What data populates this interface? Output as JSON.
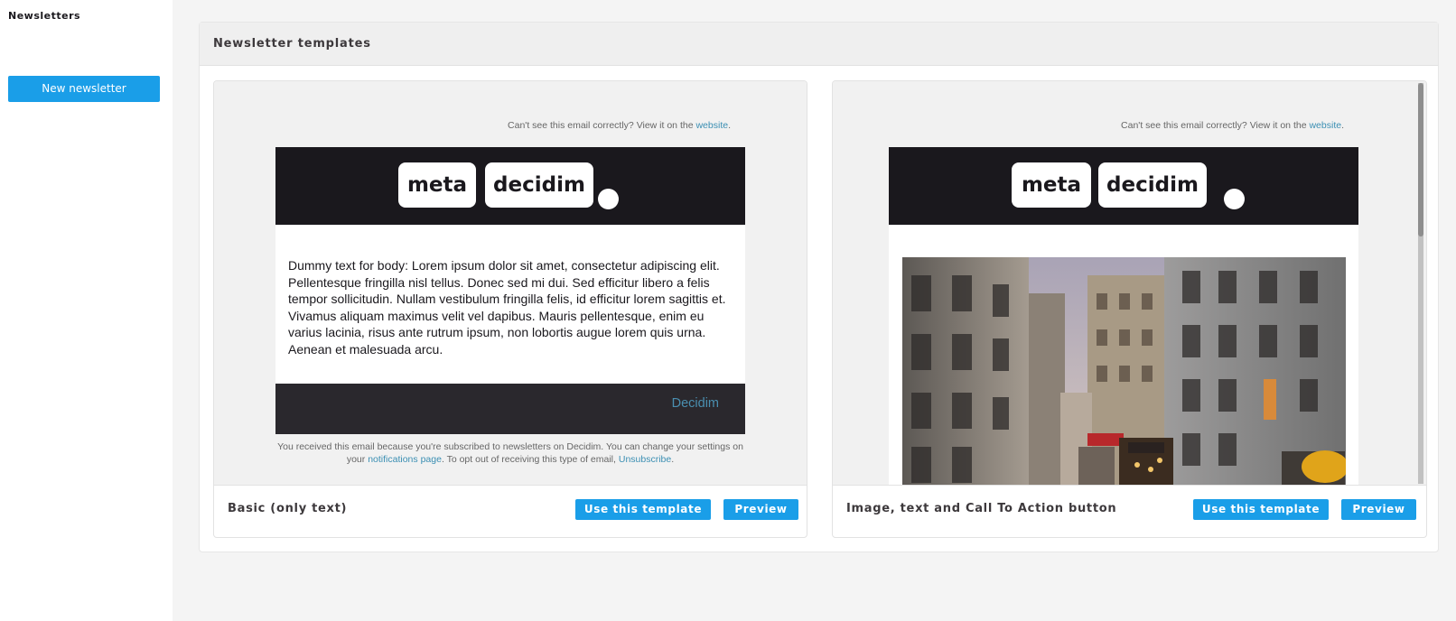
{
  "sidebar": {
    "title": "Newsletters",
    "new_button": "New newsletter"
  },
  "panel": {
    "title": "Newsletter templates"
  },
  "email": {
    "top_note": "Can't see this email correctly? View it on the",
    "top_note_link": "website",
    "top_note_end": ".",
    "logo_meta": "meta",
    "logo_decidim": "decidim",
    "body_text": "Dummy text for body: Lorem ipsum dolor sit amet, consectetur adipiscing elit. Pellentesque fringilla nisl tellus. Donec sed mi dui. Sed efficitur libero a felis tempor sollicitudin. Nullam vestibulum fringilla felis, id efficitur lorem sagittis et. Vivamus aliquam maximus velit vel dapibus. Mauris pellentesque, enim eu varius lacinia, risus ante rutrum ipsum, non lobortis augue lorem quis urna. Aenean et malesuada arcu.",
    "footer_link": "Decidim",
    "bottom_note_1": "You received this email because you're subscribed to newsletters on Decidim. You can change your settings on your",
    "bottom_note_link1": "notifications page",
    "bottom_note_2": ". To opt out of receiving this type of email,",
    "bottom_note_link2": "Unsubscribe",
    "bottom_note_end": "."
  },
  "templates": [
    {
      "name": "Basic (only text)",
      "use_label": "Use this template",
      "preview_label": "Preview"
    },
    {
      "name": "Image, text and Call To Action button",
      "use_label": "Use this template",
      "preview_label": "Preview"
    }
  ],
  "colors": {
    "accent": "#1a9ee8",
    "email_header": "#1a181d",
    "link": "#3b8fb3"
  }
}
